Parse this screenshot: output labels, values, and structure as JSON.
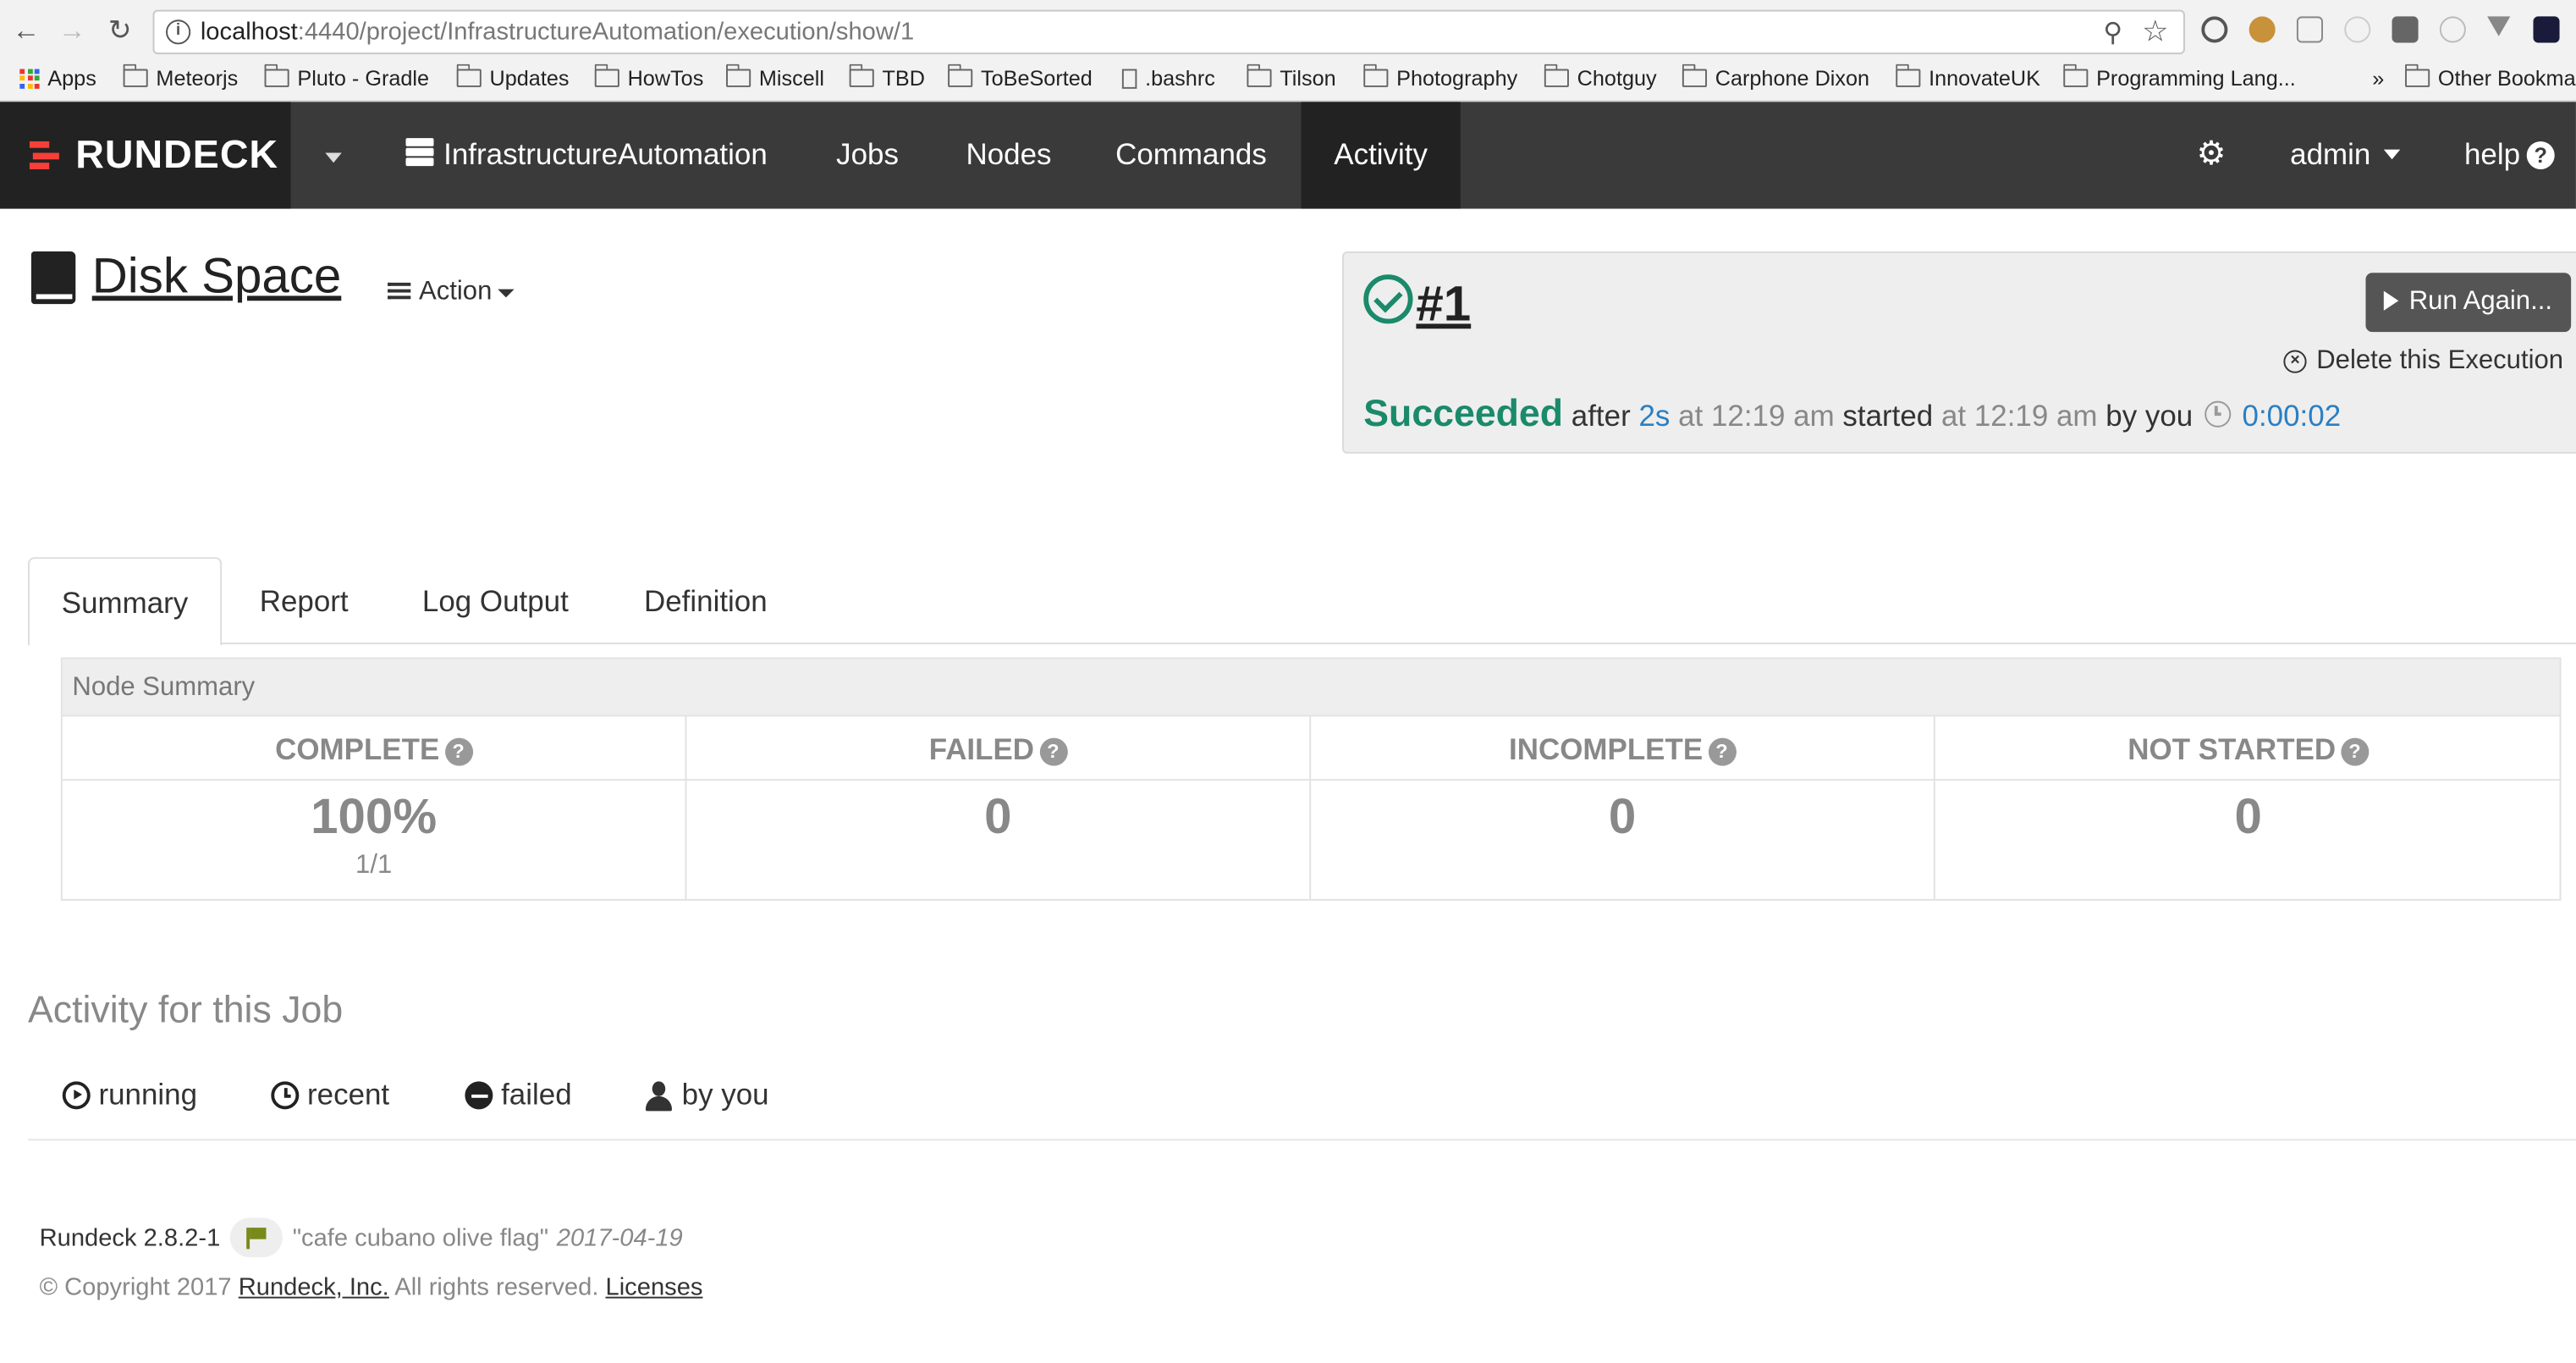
{
  "browser": {
    "url_host": "localhost",
    "url_path": ":4440/project/InfrastructureAutomation/execution/show/1",
    "bookmarks": [
      "Apps",
      "Meteorjs",
      "Pluto - Gradle",
      "Updates",
      "HowTos",
      "Miscell",
      "TBD",
      "ToBeSorted",
      ".bashrc",
      "Tilson",
      "Photography",
      "Chotguy",
      "Carphone Dixon",
      "InnovateUK",
      "Programming Lang...",
      "Other Bookma"
    ],
    "overflow": "»"
  },
  "nav": {
    "brand": "RUNDECK",
    "project": "InfrastructureAutomation",
    "items": [
      "Jobs",
      "Nodes",
      "Commands",
      "Activity"
    ],
    "active": "Activity",
    "user": "admin",
    "help": "help"
  },
  "job": {
    "name": "Disk Space",
    "action": "Action"
  },
  "execution": {
    "number": "#1",
    "run_again": "Run Again...",
    "delete": "Delete this Execution",
    "status": "Succeeded",
    "after": "after",
    "duration_short": "2s",
    "at1": "at 12:19 am",
    "started": "started",
    "at2": "at 12:19 am",
    "by": "by you",
    "duration": "0:00:02",
    "status_color": "#1a8a6a"
  },
  "tabs": [
    "Summary",
    "Report",
    "Log Output",
    "Definition"
  ],
  "node_summary": {
    "title": "Node Summary",
    "columns": [
      {
        "label": "COMPLETE",
        "value": "100%",
        "sub": "1/1"
      },
      {
        "label": "FAILED",
        "value": "0",
        "sub": ""
      },
      {
        "label": "INCOMPLETE",
        "value": "0",
        "sub": ""
      },
      {
        "label": "NOT STARTED",
        "value": "0",
        "sub": ""
      }
    ]
  },
  "activity": {
    "title": "Activity for this Job",
    "filters": [
      "running",
      "recent",
      "failed",
      "by you"
    ]
  },
  "footer": {
    "version": "Rundeck 2.8.2-1",
    "codename": "\"cafe cubano olive flag\"",
    "date": "2017-04-19",
    "copyright": "© Copyright 2017",
    "company": "Rundeck, Inc.",
    "rights": "All rights reserved.",
    "licenses": "Licenses"
  }
}
